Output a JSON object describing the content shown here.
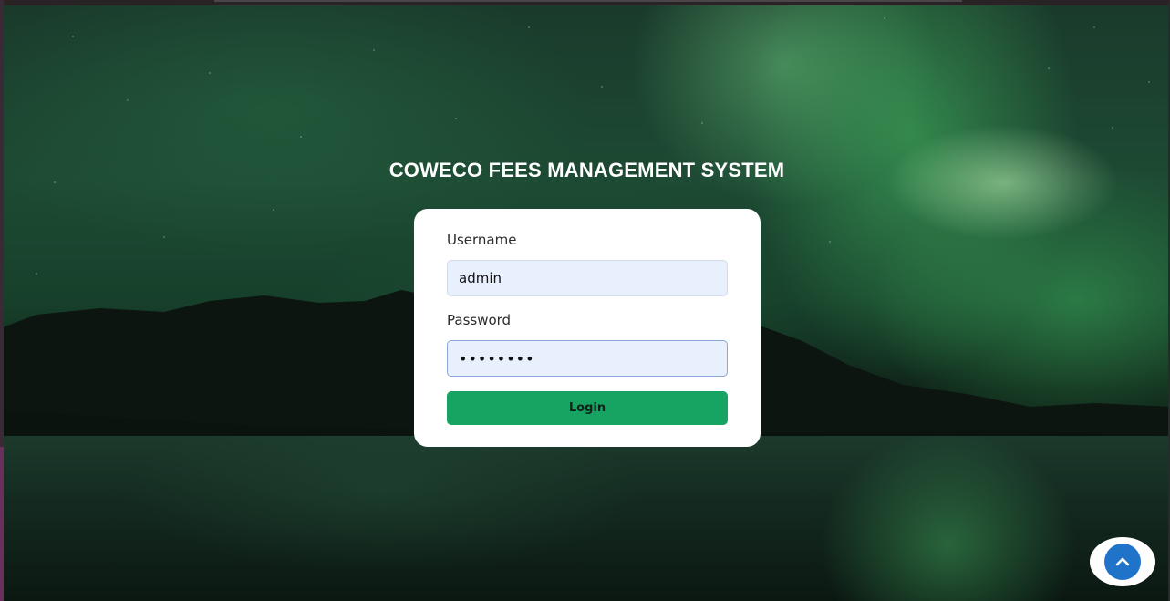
{
  "page": {
    "title": "COWECO FEES MANAGEMENT SYSTEM"
  },
  "login_form": {
    "username_label": "Username",
    "username_value": "admin",
    "password_label": "Password",
    "password_value": "••••••••",
    "login_label": "Login"
  },
  "scroll_top": {
    "icon": "chevron-up-icon"
  },
  "colors": {
    "login_button": "#17a462",
    "input_background": "#e8f0fe",
    "scroll_top_button": "#1f73c8"
  }
}
